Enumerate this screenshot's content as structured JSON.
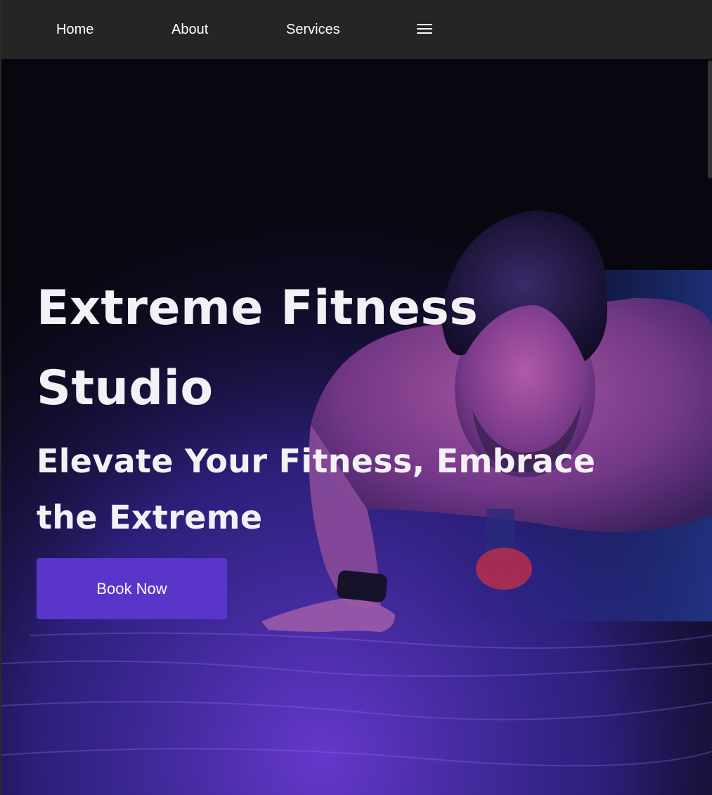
{
  "nav": {
    "items": [
      {
        "label": "Home"
      },
      {
        "label": "About"
      },
      {
        "label": "Services"
      }
    ],
    "menu_icon": "hamburger-menu-icon"
  },
  "hero": {
    "title": "Extreme Fitness Studio",
    "subtitle": "Elevate Your Fitness, Embrace the Extreme",
    "cta_label": "Book Now",
    "background_image": "man-doing-pushup-purple-lighting"
  },
  "colors": {
    "navbar_bg": "#252525",
    "hero_text": "#f3f1f6",
    "cta_bg": "#5a35c9",
    "accent_purple": "#7a3fd0"
  }
}
